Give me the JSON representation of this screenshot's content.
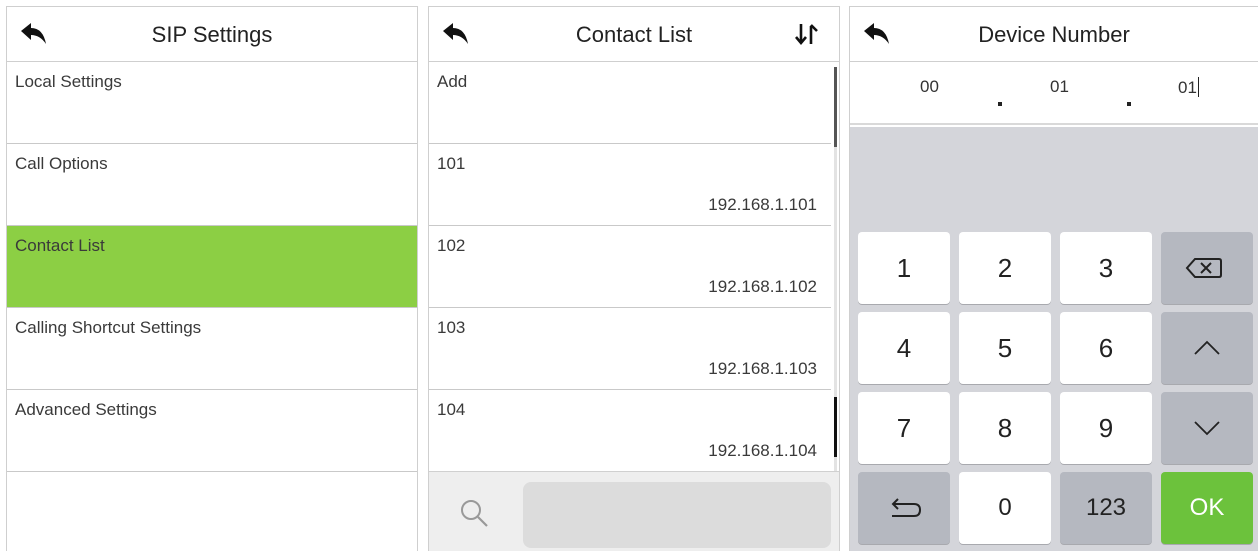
{
  "sip_panel": {
    "title": "SIP Settings",
    "items": [
      {
        "label": "Local Settings"
      },
      {
        "label": "Call Options"
      },
      {
        "label": "Contact List",
        "selected": true
      },
      {
        "label": "Calling Shortcut Settings"
      },
      {
        "label": "Advanced Settings"
      }
    ],
    "selected_color": "#8ccf44"
  },
  "contact_panel": {
    "title": "Contact List",
    "add_label": "Add",
    "contacts": [
      {
        "number": "101",
        "ip": "192.168.1.101"
      },
      {
        "number": "102",
        "ip": "192.168.1.102"
      },
      {
        "number": "103",
        "ip": "192.168.1.103"
      },
      {
        "number": "104",
        "ip": "192.168.1.104"
      }
    ],
    "search": {
      "placeholder": ""
    }
  },
  "device_panel": {
    "title": "Device Number",
    "segments": [
      "00",
      "01",
      "01"
    ],
    "keys": {
      "k1": "1",
      "k2": "2",
      "k3": "3",
      "k4": "4",
      "k5": "5",
      "k6": "6",
      "k7": "7",
      "k8": "8",
      "k9": "9",
      "k0": "0",
      "mode": "123",
      "ok": "OK"
    },
    "ok_color": "#6cc23c"
  }
}
